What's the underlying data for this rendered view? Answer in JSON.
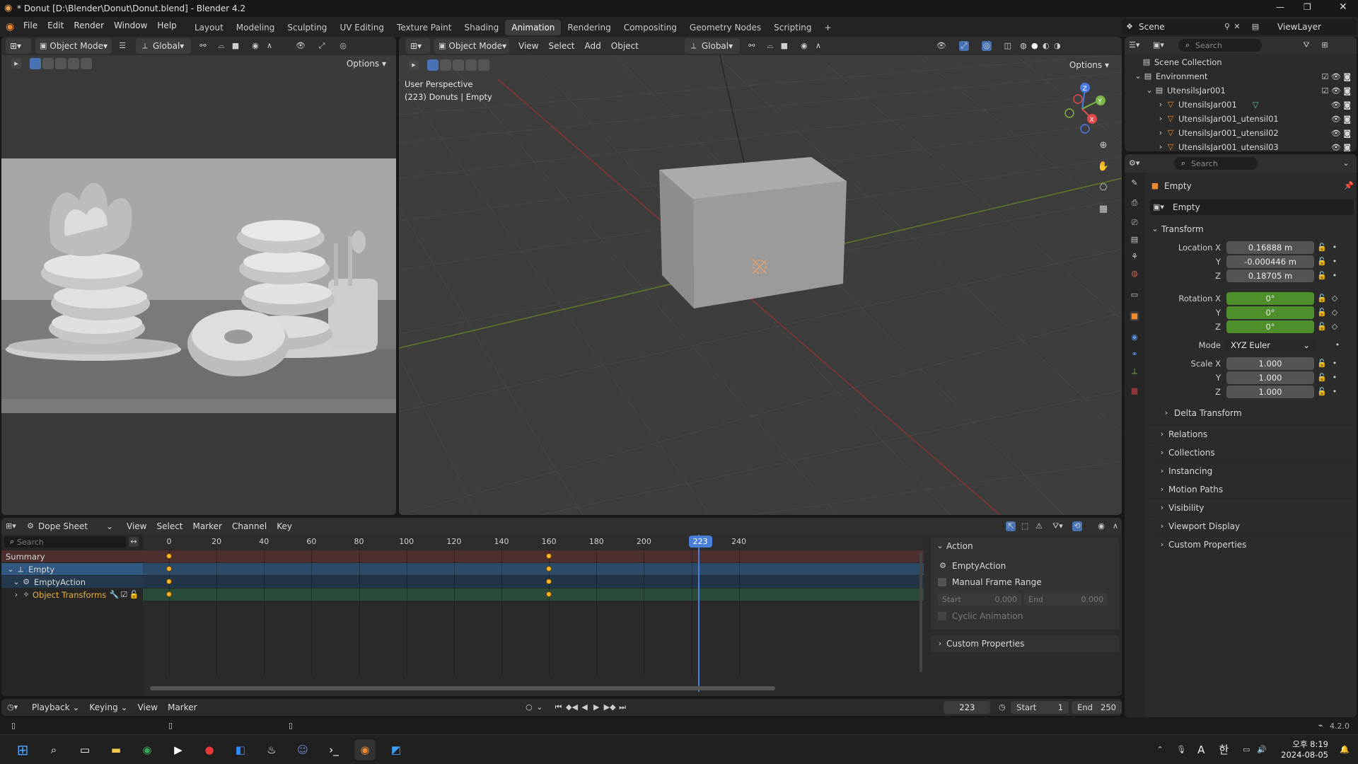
{
  "window": {
    "title": "* Donut [D:\\Blender\\Donut\\Donut.blend] - Blender 4.2"
  },
  "menu": {
    "items": [
      "File",
      "Edit",
      "Render",
      "Window",
      "Help"
    ]
  },
  "workspaces": [
    "Layout",
    "Modeling",
    "Sculpting",
    "UV Editing",
    "Texture Paint",
    "Shading",
    "Animation",
    "Rendering",
    "Compositing",
    "Geometry Nodes",
    "Scripting"
  ],
  "active_workspace": "Animation",
  "scene": {
    "name": "Scene",
    "view_layer": "ViewLayer"
  },
  "left_view": {
    "mode": "Object Mode",
    "orientation": "Global",
    "options": "Options"
  },
  "main_view": {
    "mode": "Object Mode",
    "menus": [
      "View",
      "Select",
      "Add",
      "Object"
    ],
    "orientation": "Global",
    "options": "Options",
    "overlay_line1": "User Perspective",
    "overlay_line2": "(223) Donuts | Empty"
  },
  "outliner": {
    "search_placeholder": "Search",
    "items": [
      {
        "label": "Scene Collection"
      },
      {
        "label": "Environment"
      },
      {
        "label": "UtensilsJar001"
      },
      {
        "label": "UtensilsJar001"
      },
      {
        "label": "UtensilsJar001_utensil01"
      },
      {
        "label": "UtensilsJar001_utensil02"
      },
      {
        "label": "UtensilsJar001_utensil03"
      }
    ]
  },
  "properties": {
    "search_placeholder": "Search",
    "object_name": "Empty",
    "datablock": "Empty",
    "transform_title": "Transform",
    "location": {
      "label": "Location X",
      "x": "0.16888 m",
      "y": "-0.000446 m",
      "z": "0.18705 m"
    },
    "rotation": {
      "label": "Rotation X",
      "x": "0°",
      "y": "0°",
      "z": "0°"
    },
    "mode": {
      "label": "Mode",
      "value": "XYZ Euler"
    },
    "scale": {
      "label": "Scale X",
      "x": "1.000",
      "y": "1.000",
      "z": "1.000"
    },
    "axis_y": "Y",
    "axis_z": "Z",
    "delta": "Delta Transform",
    "sections": [
      "Relations",
      "Collections",
      "Instancing",
      "Motion Paths",
      "Visibility",
      "Viewport Display",
      "Custom Properties"
    ]
  },
  "dopesheet": {
    "editor": "Dope Sheet",
    "menus": [
      "View",
      "Select",
      "Marker",
      "Channel",
      "Key"
    ],
    "search_placeholder": "Search",
    "ruler": [
      "0",
      "20",
      "40",
      "60",
      "80",
      "100",
      "120",
      "140",
      "160",
      "180",
      "200",
      "2",
      "240"
    ],
    "current_frame": "223",
    "channels": [
      {
        "label": "Summary"
      },
      {
        "label": "Empty"
      },
      {
        "label": "EmptyAction"
      },
      {
        "label": "Object Transforms"
      }
    ],
    "keyframes": [
      0,
      160
    ],
    "frame_min": 0,
    "frame_max": 250,
    "action_panel": {
      "title": "Action",
      "action_name": "EmptyAction",
      "manual_range": "Manual Frame Range",
      "start_label": "Start",
      "start_value": "0.000",
      "end_label": "End",
      "end_value": "0.000",
      "cyclic": "Cyclic Animation",
      "custom": "Custom Properties"
    }
  },
  "timeline": {
    "menus": [
      "Playback",
      "Keying",
      "View",
      "Marker"
    ],
    "current": "223",
    "start_label": "Start",
    "start": "1",
    "end_label": "End",
    "end": "250"
  },
  "status": {
    "version": "4.2.0"
  },
  "taskbar": {
    "time": "오후 8:19",
    "date": "2024-08-05",
    "ime": "A",
    "lang": "한"
  }
}
